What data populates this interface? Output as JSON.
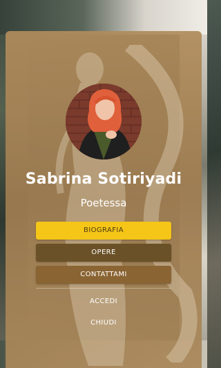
{
  "profile": {
    "name": "Sabrina Sotiriyadi",
    "role": "Poetessa"
  },
  "menu": {
    "biografia_label": "BIOGRAFIA",
    "opere_label": "OPERE",
    "contattami_label": "CONTATTAMI",
    "accedi_label": "ACCEDI",
    "chiudi_label": "CHIUDI"
  },
  "colors": {
    "card": "#a98555",
    "primary_button": "#f5c518",
    "secondary_button": "#6b5128",
    "tertiary_button": "#8a6433"
  }
}
